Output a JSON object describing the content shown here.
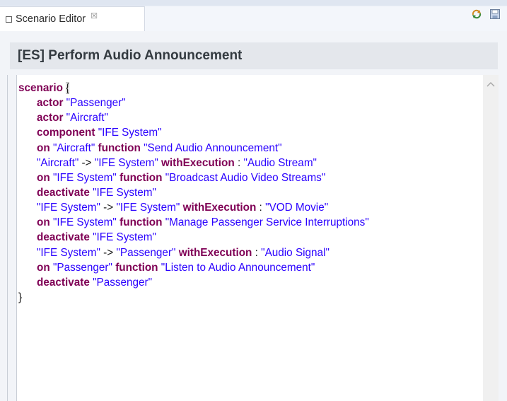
{
  "tab": {
    "label": "Scenario Editor",
    "close_glyph": "☒"
  },
  "toolbar": {
    "refresh_icon": "refresh-icon",
    "save_icon": "save-icon"
  },
  "editor": {
    "title": "[ES] Perform Audio Announcement",
    "lines": [
      [
        {
          "k": "kw",
          "t": "scenario"
        },
        {
          "k": "plain",
          "t": " "
        },
        {
          "k": "brace-open",
          "t": "{"
        }
      ],
      [
        {
          "k": "kw",
          "t": "actor"
        },
        {
          "k": "plain",
          "t": " "
        },
        {
          "k": "str",
          "t": "\"Passenger\""
        }
      ],
      [
        {
          "k": "kw",
          "t": "actor"
        },
        {
          "k": "plain",
          "t": " "
        },
        {
          "k": "str",
          "t": "\"Aircraft\""
        }
      ],
      [
        {
          "k": "kw",
          "t": "component"
        },
        {
          "k": "plain",
          "t": " "
        },
        {
          "k": "str",
          "t": "\"IFE System\""
        }
      ],
      [
        {
          "k": "kw",
          "t": "on"
        },
        {
          "k": "plain",
          "t": " "
        },
        {
          "k": "str",
          "t": "\"Aircraft\""
        },
        {
          "k": "plain",
          "t": " "
        },
        {
          "k": "kw",
          "t": "function"
        },
        {
          "k": "plain",
          "t": " "
        },
        {
          "k": "str",
          "t": "\"Send Audio Announcement\""
        }
      ],
      [
        {
          "k": "str",
          "t": "\"Aircraft\""
        },
        {
          "k": "plain",
          "t": " -> "
        },
        {
          "k": "str",
          "t": "\"IFE System\""
        },
        {
          "k": "plain",
          "t": " "
        },
        {
          "k": "kw",
          "t": "withExecution"
        },
        {
          "k": "plain",
          "t": " : "
        },
        {
          "k": "str",
          "t": "\"Audio Stream\""
        }
      ],
      [
        {
          "k": "kw",
          "t": "on"
        },
        {
          "k": "plain",
          "t": " "
        },
        {
          "k": "str",
          "t": "\"IFE System\""
        },
        {
          "k": "plain",
          "t": " "
        },
        {
          "k": "kw",
          "t": "function"
        },
        {
          "k": "plain",
          "t": " "
        },
        {
          "k": "str",
          "t": "\"Broadcast Audio Video Streams\""
        }
      ],
      [
        {
          "k": "kw",
          "t": "deactivate"
        },
        {
          "k": "plain",
          "t": " "
        },
        {
          "k": "str",
          "t": "\"IFE System\""
        }
      ],
      [
        {
          "k": "str",
          "t": "\"IFE System\""
        },
        {
          "k": "plain",
          "t": " -> "
        },
        {
          "k": "str",
          "t": "\"IFE System\""
        },
        {
          "k": "plain",
          "t": " "
        },
        {
          "k": "kw",
          "t": "withExecution"
        },
        {
          "k": "plain",
          "t": " : "
        },
        {
          "k": "str",
          "t": "\"VOD Movie\""
        }
      ],
      [
        {
          "k": "kw",
          "t": "on"
        },
        {
          "k": "plain",
          "t": " "
        },
        {
          "k": "str",
          "t": "\"IFE System\""
        },
        {
          "k": "plain",
          "t": " "
        },
        {
          "k": "kw",
          "t": "function"
        },
        {
          "k": "plain",
          "t": " "
        },
        {
          "k": "str",
          "t": "\"Manage Passenger Service Interruptions\""
        }
      ],
      [
        {
          "k": "kw",
          "t": "deactivate"
        },
        {
          "k": "plain",
          "t": " "
        },
        {
          "k": "str",
          "t": "\"IFE System\""
        }
      ],
      [
        {
          "k": "str",
          "t": "\"IFE System\""
        },
        {
          "k": "plain",
          "t": " -> "
        },
        {
          "k": "str",
          "t": "\"Passenger\""
        },
        {
          "k": "plain",
          "t": " "
        },
        {
          "k": "kw",
          "t": "withExecution"
        },
        {
          "k": "plain",
          "t": " : "
        },
        {
          "k": "str",
          "t": "\"Audio Signal\""
        }
      ],
      [
        {
          "k": "kw",
          "t": "on"
        },
        {
          "k": "plain",
          "t": " "
        },
        {
          "k": "str",
          "t": "\"Passenger\""
        },
        {
          "k": "plain",
          "t": " "
        },
        {
          "k": "kw",
          "t": "function"
        },
        {
          "k": "plain",
          "t": " "
        },
        {
          "k": "str",
          "t": "\"Listen to Audio Announcement\""
        }
      ],
      [
        {
          "k": "kw",
          "t": "deactivate"
        },
        {
          "k": "plain",
          "t": " "
        },
        {
          "k": "str",
          "t": "\"Passenger\""
        }
      ],
      [
        {
          "k": "plain",
          "t": "}"
        }
      ]
    ]
  },
  "colors": {
    "keyword": "#7f0055",
    "string": "#2a00ff",
    "title_bg": "#e4e7ec"
  }
}
